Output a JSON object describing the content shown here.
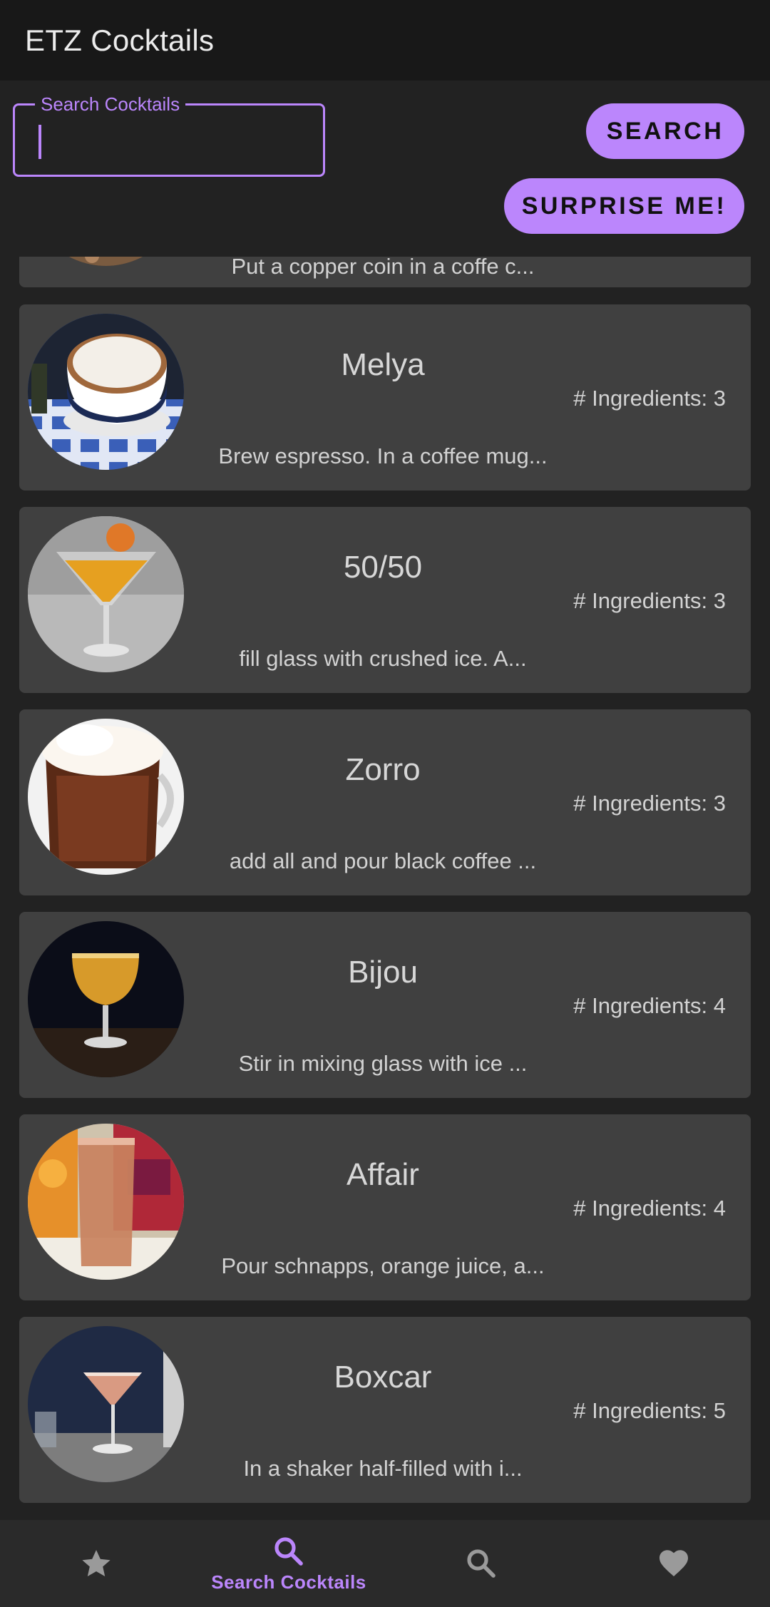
{
  "app": {
    "title": "ETZ Cocktails"
  },
  "search": {
    "label": "Search Cocktails",
    "value": "",
    "search_button": "SEARCH",
    "surprise_button": "SURPRISE ME!"
  },
  "partial_card": {
    "description": "Put a copper coin in a coffe c..."
  },
  "cocktails": [
    {
      "name": "Melya",
      "ingredients": "# Ingredients: 3",
      "description": "Brew espresso. In a coffee mug..."
    },
    {
      "name": "50/50",
      "ingredients": "# Ingredients: 3",
      "description": "fill glass with crushed ice. A..."
    },
    {
      "name": "Zorro",
      "ingredients": "# Ingredients: 3",
      "description": "add all and pour black coffee ..."
    },
    {
      "name": "Bijou",
      "ingredients": "# Ingredients: 4",
      "description": "Stir in mixing glass with ice ..."
    },
    {
      "name": "Affair",
      "ingredients": "# Ingredients: 4",
      "description": "Pour schnapps, orange juice, a..."
    },
    {
      "name": "Boxcar",
      "ingredients": "# Ingredients: 5",
      "description": "In a shaker half-filled with i..."
    }
  ],
  "nav": {
    "items": [
      {
        "icon": "star-icon",
        "label": ""
      },
      {
        "icon": "search-icon",
        "label": "Search Cocktails",
        "active": true
      },
      {
        "icon": "search-icon",
        "label": ""
      },
      {
        "icon": "heart-icon",
        "label": ""
      }
    ]
  },
  "colors": {
    "accent": "#bb86fc",
    "card": "#404040",
    "background": "#222222"
  }
}
